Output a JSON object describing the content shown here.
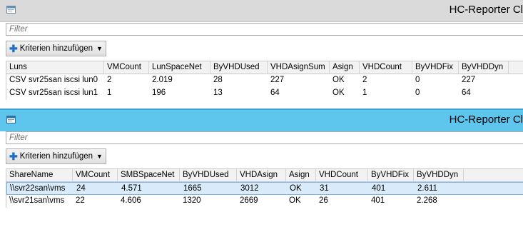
{
  "window1": {
    "title": "HC-Reporter Cl",
    "filter_placeholder": "Filter",
    "button_label": "Kriterien hinzufügen",
    "columns": [
      "Luns",
      "VMCount",
      "LunSpaceNet",
      "ByVHDUsed",
      "VHDAsignSum",
      "Asign",
      "VHDCount",
      "ByVHDFix",
      "ByVHDDyn"
    ],
    "rows": [
      [
        "CSV svr25san iscsi lun0",
        "2",
        "2.019",
        "28",
        "227",
        "OK",
        "2",
        "0",
        "227"
      ],
      [
        "CSV svr25san iscsi lun1",
        "1",
        "196",
        "13",
        "64",
        "OK",
        "1",
        "0",
        "64"
      ]
    ]
  },
  "window2": {
    "title": "HC-Reporter Cl",
    "filter_placeholder": "Filter",
    "button_label": "Kriterien hinzufügen",
    "columns": [
      "ShareName",
      "VMCount",
      "SMBSpaceNet",
      "ByVHDUsed",
      "VHDAsign",
      "Asign",
      "VHDCount",
      "ByVHDFix",
      "ByVHDDyn"
    ],
    "rows": [
      [
        "\\\\svr22san\\vms",
        "24",
        "4.571",
        "1665",
        "3012",
        "OK",
        "31",
        "401",
        "2.611"
      ],
      [
        "\\\\svr21san\\vms",
        "22",
        "4.606",
        "1320",
        "2669",
        "OK",
        "26",
        "401",
        "2.268"
      ]
    ],
    "selected_row": 0
  }
}
